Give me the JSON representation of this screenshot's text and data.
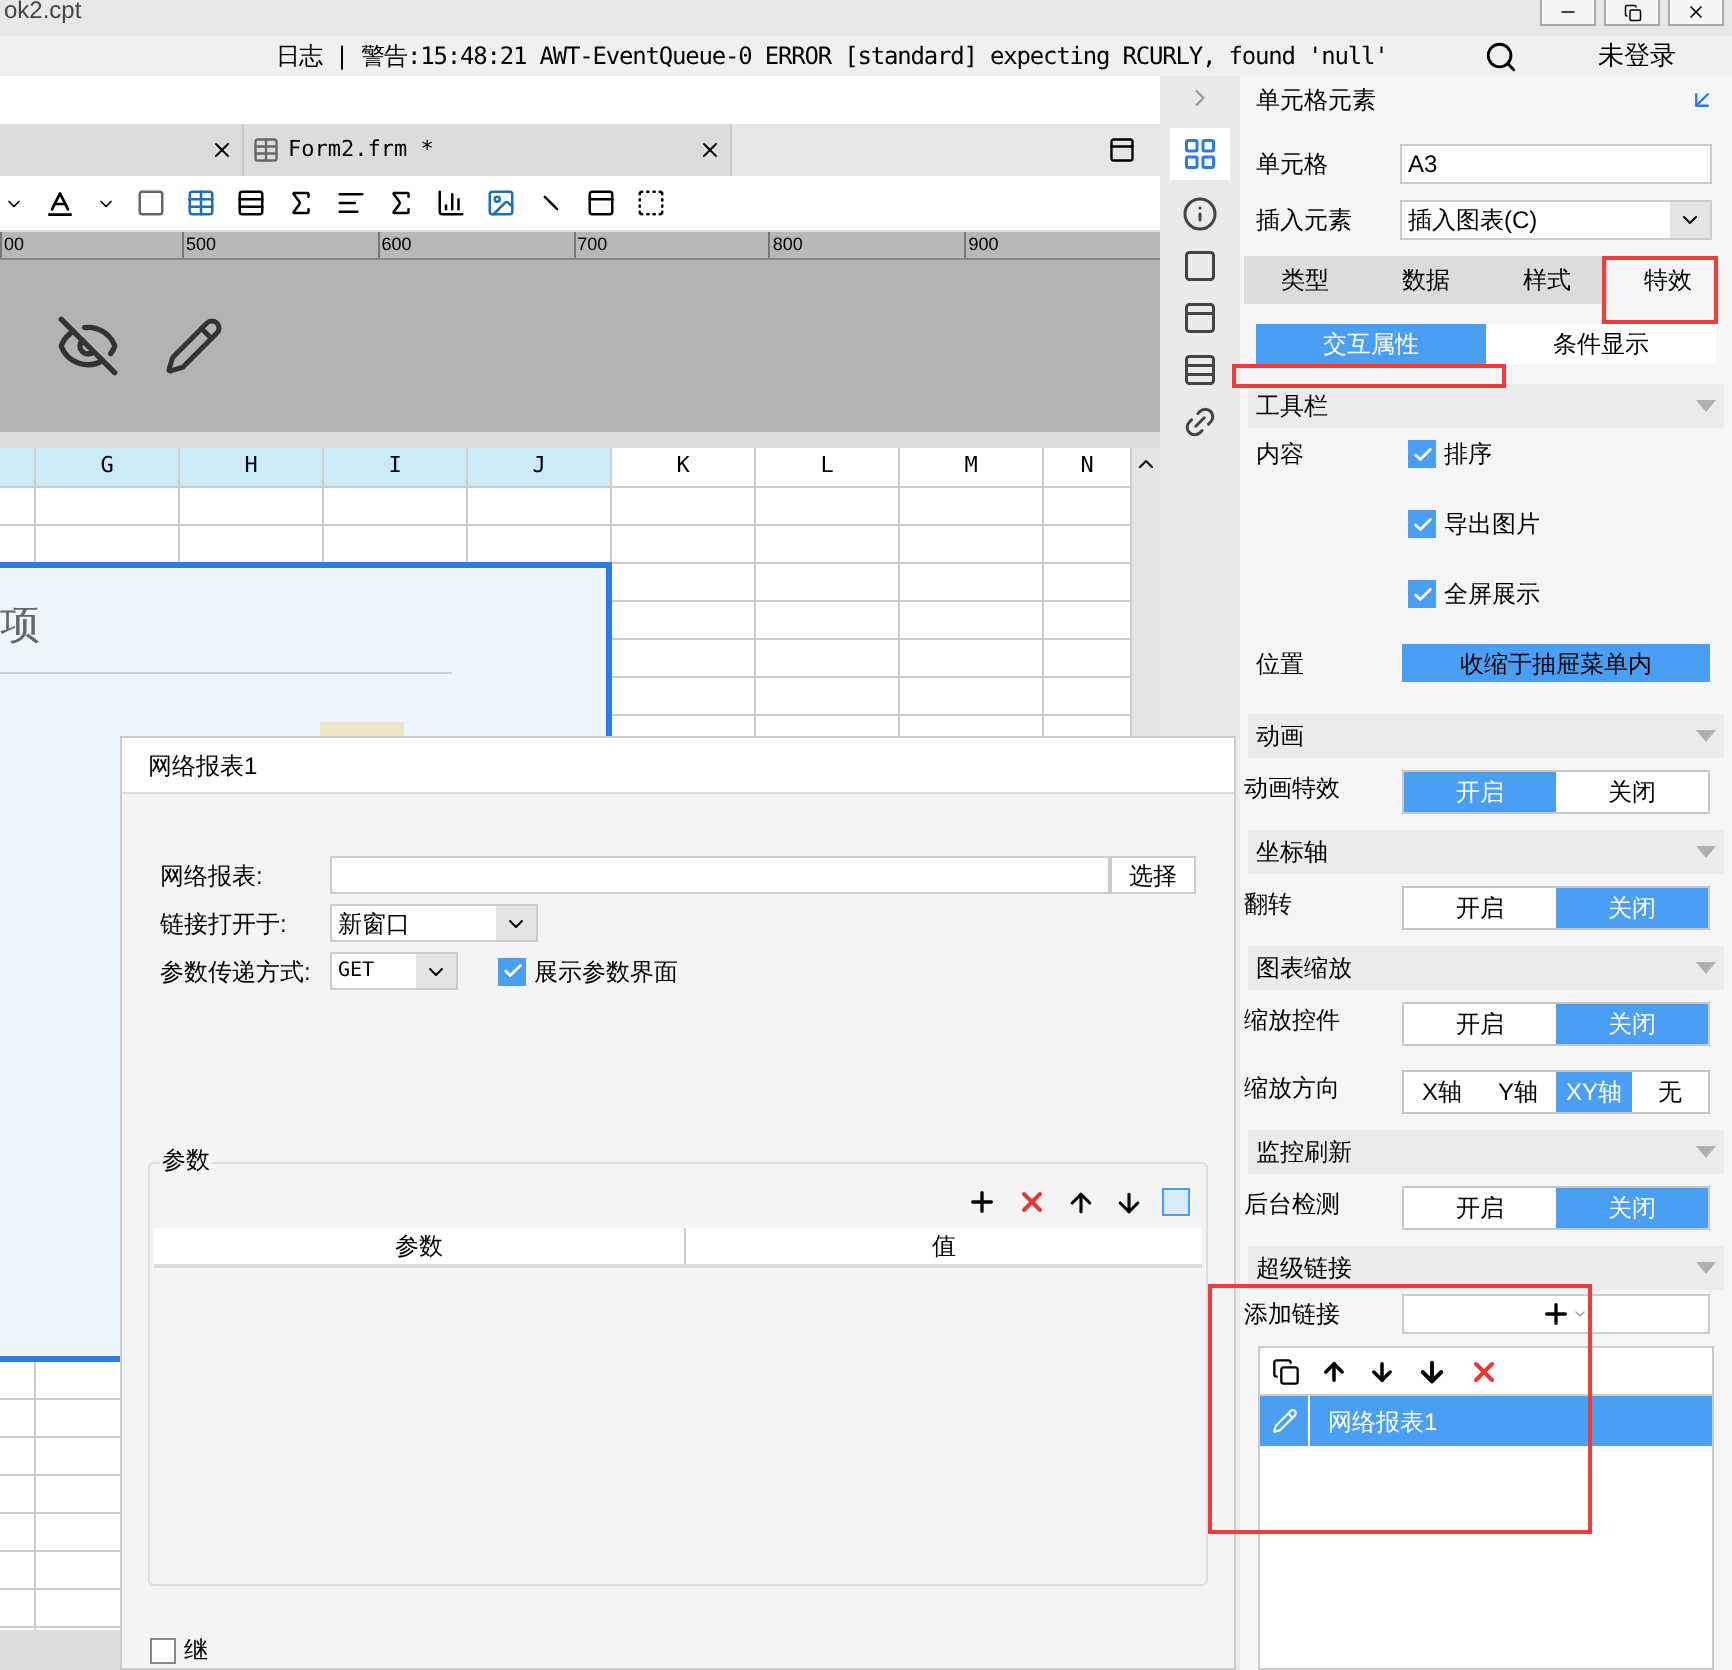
{
  "window": {
    "title": "ok2.cpt"
  },
  "log_bar": {
    "message": "日志 | 警告:15:48:21 AWT-EventQueue-0 ERROR [standard] expecting RCURLY, found 'null'",
    "login": "未登录"
  },
  "file_tabs": [
    {
      "selected": false
    },
    {
      "label": "Form2.frm *",
      "selected": false
    }
  ],
  "ruler": {
    "labels": [
      "00",
      "500",
      "600",
      "700",
      "800",
      "900"
    ]
  },
  "sheet": {
    "columns": [
      {
        "label": "G",
        "selected": true
      },
      {
        "label": "H",
        "selected": true
      },
      {
        "label": "I",
        "selected": true
      },
      {
        "label": "J",
        "selected": true
      },
      {
        "label": "K",
        "selected": false
      },
      {
        "label": "L",
        "selected": false
      },
      {
        "label": "M",
        "selected": false
      },
      {
        "label": "N",
        "selected": false
      }
    ],
    "chart_title": "项"
  },
  "dialog": {
    "title": "网络报表1",
    "report_label": "网络报表:",
    "choose_button": "选择",
    "open_label": "链接打开于:",
    "open_value": "新窗口",
    "method_label": "参数传递方式:",
    "method_value": "GET",
    "show_params": {
      "label": "展示参数界面",
      "checked": true
    },
    "params_group": "参数",
    "param_columns": [
      "参数",
      "值"
    ],
    "inherit": {
      "label": "继",
      "checked": false
    }
  },
  "panel": {
    "title": "单元格元素",
    "cell_label": "单元格",
    "cell_value": "A3",
    "insert_label": "插入元素",
    "insert_value": "插入图表(C)",
    "tabs": [
      {
        "label": "类型",
        "selected": false
      },
      {
        "label": "数据",
        "selected": false
      },
      {
        "label": "样式",
        "selected": false
      },
      {
        "label": "特效",
        "selected": true
      }
    ],
    "subtabs": [
      {
        "label": "交互属性",
        "selected": true
      },
      {
        "label": "条件显示",
        "selected": false
      }
    ],
    "sections": [
      {
        "title": "工具栏",
        "rows": [
          {
            "kind": "checks",
            "label": "内容",
            "items": [
              {
                "label": "排序",
                "checked": true
              },
              {
                "label": "导出图片",
                "checked": true
              },
              {
                "label": "全屏展示",
                "checked": true
              }
            ]
          },
          {
            "kind": "button",
            "label": "位置",
            "value": "收缩于抽屉菜单内"
          }
        ]
      },
      {
        "title": "动画",
        "rows": [
          {
            "kind": "toggle",
            "label": "动画特效",
            "options": [
              {
                "label": "开启",
                "selected": true
              },
              {
                "label": "关闭",
                "selected": false
              }
            ]
          }
        ]
      },
      {
        "title": "坐标轴",
        "rows": [
          {
            "kind": "toggle",
            "label": "翻转",
            "options": [
              {
                "label": "开启",
                "selected": false
              },
              {
                "label": "关闭",
                "selected": true
              }
            ]
          }
        ]
      },
      {
        "title": "图表缩放",
        "rows": [
          {
            "kind": "toggle",
            "label": "缩放控件",
            "options": [
              {
                "label": "开启",
                "selected": false
              },
              {
                "label": "关闭",
                "selected": true
              }
            ]
          },
          {
            "kind": "toggle",
            "label": "缩放方向",
            "options": [
              {
                "label": "X轴",
                "selected": false
              },
              {
                "label": "Y轴",
                "selected": false
              },
              {
                "label": "XY轴",
                "selected": true
              },
              {
                "label": "无",
                "selected": false
              }
            ]
          }
        ]
      },
      {
        "title": "监控刷新",
        "rows": [
          {
            "kind": "toggle",
            "label": "后台检测",
            "options": [
              {
                "label": "开启",
                "selected": false
              },
              {
                "label": "关闭",
                "selected": true
              }
            ]
          }
        ]
      },
      {
        "title": "超级链接",
        "rows": [
          {
            "kind": "add",
            "label": "添加链接"
          }
        ]
      }
    ],
    "links": [
      {
        "label": "网络报表1",
        "selected": true
      }
    ]
  }
}
